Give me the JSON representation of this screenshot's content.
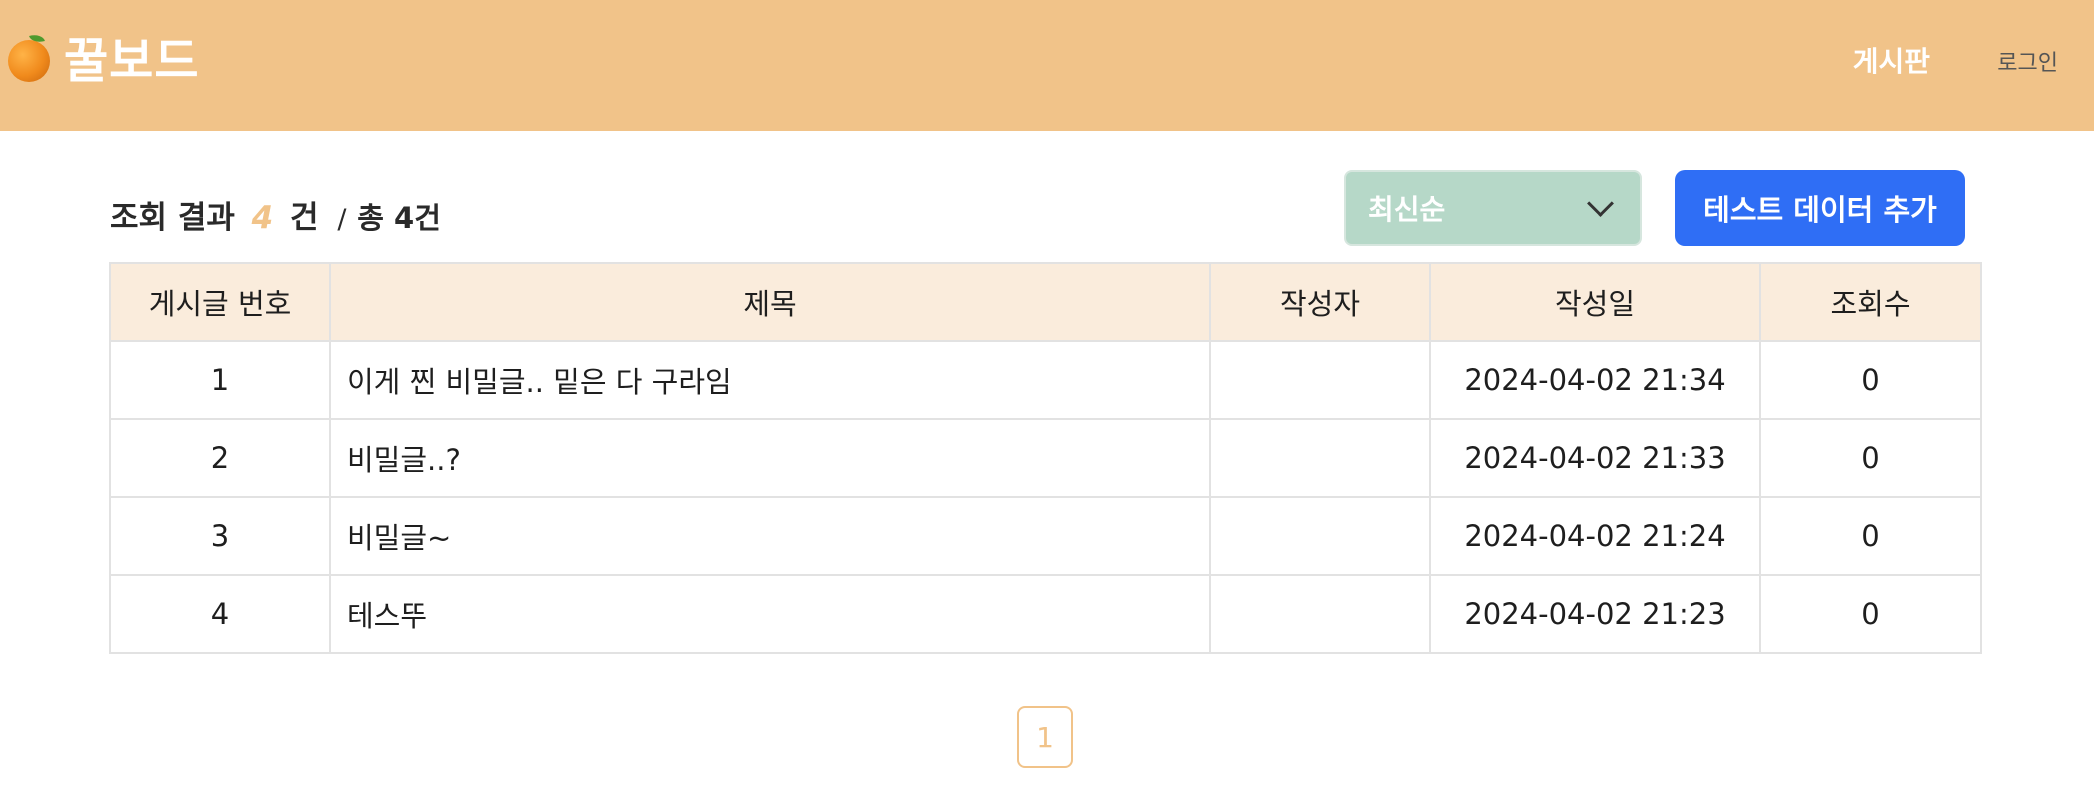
{
  "header": {
    "logo_icon": "orange-icon",
    "logo_text": "꿀보드",
    "nav_board": "게시판",
    "nav_login": "로그인",
    "background_color": "#f1c389"
  },
  "summary": {
    "prefix": "조회 결과",
    "count": "4",
    "unit": "건",
    "slash": "/",
    "total": "총 4건"
  },
  "sort": {
    "selected": "최신순",
    "icon": "chevron-down-icon",
    "color": "#b6d8c8"
  },
  "actions": {
    "add_test_data": "테스트 데이터 추가",
    "button_color": "#2f6ef5"
  },
  "table": {
    "headers": [
      "게시글 번호",
      "제목",
      "작성자",
      "작성일",
      "조회수"
    ],
    "rows": [
      {
        "id": "1",
        "title": "이게 찐 비밀글.. 밑은 다 구라임",
        "author": "",
        "date": "2024-04-02 21:34",
        "views": "0"
      },
      {
        "id": "2",
        "title": "비밀글..?",
        "author": "",
        "date": "2024-04-02 21:33",
        "views": "0"
      },
      {
        "id": "3",
        "title": "비밀글~",
        "author": "",
        "date": "2024-04-02 21:24",
        "views": "0"
      },
      {
        "id": "4",
        "title": "테스뚜",
        "author": "",
        "date": "2024-04-02 21:23",
        "views": "0"
      }
    ]
  },
  "pagination": {
    "pages": [
      "1"
    ],
    "current": "1"
  }
}
